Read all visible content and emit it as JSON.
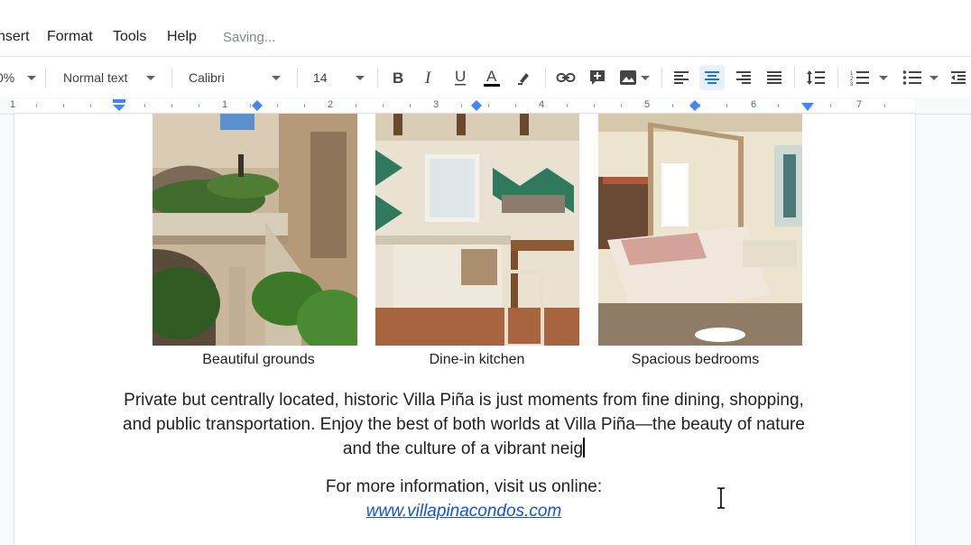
{
  "menu": {
    "items": [
      "nsert",
      "Format",
      "Tools",
      "Help"
    ],
    "status": "Saving..."
  },
  "toolbar": {
    "zoom": "0%",
    "style": "Normal text",
    "font": "Calibri",
    "size": "14",
    "text_color": "#000000",
    "accent": "#1a73e8"
  },
  "ruler": {
    "numbers": [
      "1",
      "1",
      "2",
      "3",
      "4",
      "5",
      "6",
      "7"
    ]
  },
  "images": [
    {
      "caption": "Beautiful grounds"
    },
    {
      "caption": "Dine-in kitchen"
    },
    {
      "caption": "Spacious bedrooms"
    }
  ],
  "body": {
    "paragraph": "Private but centrally located, historic Villa Piña is just moments from fine dining, shopping, and public transportation. Enjoy the best of both worlds at Villa Piña—the beauty of nature and the culture of a vibrant neig",
    "more_info": "For more information, visit us online:",
    "link": "www.villapinacondos.com"
  }
}
